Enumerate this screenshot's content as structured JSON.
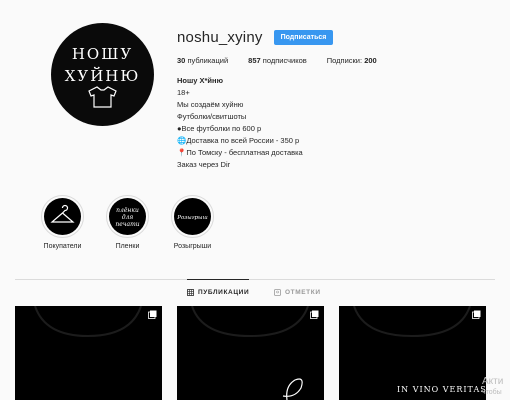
{
  "profile": {
    "username": "noshu_xyiny",
    "follow_label": "Подписаться",
    "avatar_text_top": "НОШУ",
    "avatar_text_bottom": "ХУЙНЮ",
    "stats": {
      "posts_count": "30",
      "posts_label": "публикаций",
      "followers_count": "857",
      "followers_label": "подписчиков",
      "following_label": "Подписки:",
      "following_count": "200"
    },
    "bio": {
      "name": "Ношу Х*йню",
      "lines": [
        "18+",
        "Мы создаём хуйню",
        "Футболки/свитшоты",
        "●Все футболки по 600 р",
        "🌐Доставка по всей России - 350 р",
        "📍По Томску - бесплатная доставка",
        "Заказ через Dir"
      ]
    }
  },
  "highlights": [
    {
      "label": "Покупатели",
      "icon": "hanger-icon"
    },
    {
      "label": "Пленки",
      "icon": "lettering-icon",
      "cover_text": [
        "плёнки",
        "для",
        "печати"
      ]
    },
    {
      "label": "Розыгрыши",
      "icon": "lettering-icon",
      "cover_text": [
        "Розыгрыш"
      ]
    }
  ],
  "tabs": [
    {
      "label": "ПУБЛИКАЦИИ",
      "icon": "grid-icon",
      "active": true
    },
    {
      "label": "ОТМЕТКИ",
      "icon": "tag-icon",
      "active": false
    }
  ],
  "posts": [
    {
      "caption": ""
    },
    {
      "caption": ""
    },
    {
      "caption": "IN VINO VERITAS"
    }
  ],
  "watermark": {
    "line1": "Акти",
    "line2": "чтобы"
  },
  "colors": {
    "accent": "#3897f0",
    "background": "#fafafa",
    "text": "#262626",
    "muted": "#999999"
  }
}
